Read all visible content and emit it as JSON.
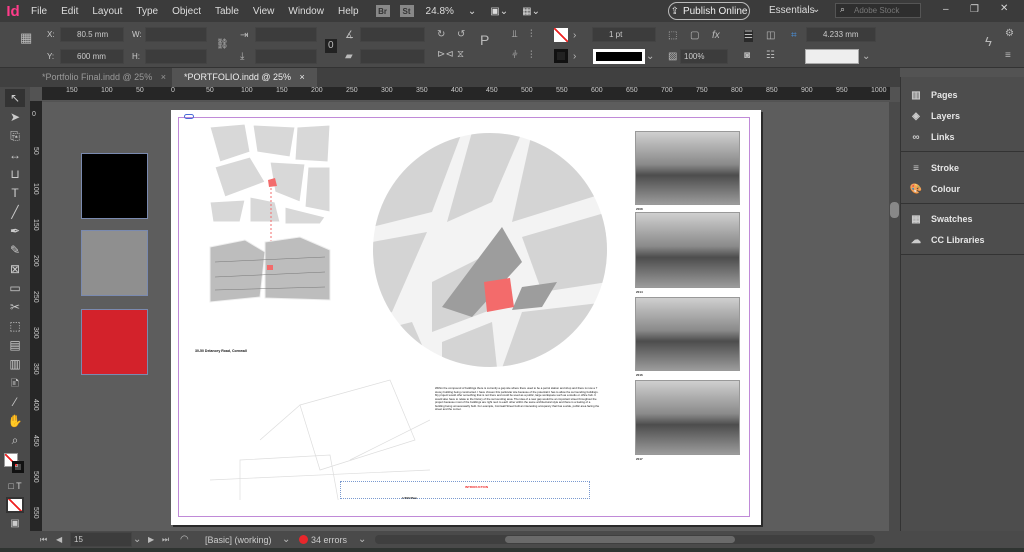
{
  "app": {
    "logo": "Id"
  },
  "menu": [
    "File",
    "Edit",
    "Layout",
    "Type",
    "Object",
    "Table",
    "View",
    "Window",
    "Help"
  ],
  "menubar": {
    "bridge": "Br",
    "stock_app": "St",
    "zoom": "24.8%",
    "publish": "Publish Online",
    "workspace": "Essentials",
    "search_placeholder": "Adobe Stock"
  },
  "control": {
    "x_label": "X:",
    "x_value": "80.5 mm",
    "y_label": "Y:",
    "y_value": "600 mm",
    "w_label": "W:",
    "h_label": "H:",
    "stroke_weight": "1 pt",
    "opacity": "100%",
    "offset": "4.233 mm"
  },
  "tabs": [
    {
      "label": "*Portfolio Final.indd @ 25%",
      "active": false
    },
    {
      "label": "*PORTFOLIO.indd @ 25%",
      "active": true
    }
  ],
  "close_glyph": "×",
  "hruler": [
    "150",
    "100",
    "50",
    "0",
    "50",
    "100",
    "150",
    "200",
    "250",
    "300",
    "350",
    "400",
    "450",
    "500",
    "550",
    "600",
    "650",
    "700",
    "750",
    "800",
    "850",
    "900",
    "950",
    "1000"
  ],
  "vruler": [
    "0",
    "50",
    "100",
    "150",
    "200",
    "250",
    "300",
    "350",
    "400",
    "450",
    "500",
    "550"
  ],
  "swatches": [
    {
      "name": "black",
      "color": "#000000"
    },
    {
      "name": "grey",
      "color": "#8f8f8f"
    },
    {
      "name": "red",
      "color": "#d3222b"
    }
  ],
  "page": {
    "address": "30-50 Delancey Road, Cornwall",
    "body_text": "Within the compound of buildings there is currently a gap site where there used to be a petrol station and shop and there is now a 7 storey building being constructed. I have chosen this particular site because of the potential it has to allow the surrounding buildings. My project would offer something that is not there and could be used as a public, large workspace such as a studio or office hub. It would also have to relate to the history of the surrounding area. The idea of a new gap would be an important street throughout the project because most of the buildings are right next to each other within the same architectural style and there is a feeling of a building being unnecessarily built. For example, Cornwall Street built an interesting occupancy that has a wide, public area facing the street and the corner.",
    "heading_red": "INTRODUCTION",
    "plan_label": "1:500 Plan",
    "photo_captions": [
      "2008",
      "2014",
      "2016",
      "2017"
    ],
    "highlight": "#f36b6b"
  },
  "panels": [
    {
      "group": 1,
      "items": [
        "Pages",
        "Layers",
        "Links"
      ]
    },
    {
      "group": 2,
      "items": [
        "Stroke",
        "Colour"
      ]
    },
    {
      "group": 3,
      "items": [
        "Swatches",
        "CC Libraries"
      ]
    }
  ],
  "status": {
    "page": "15",
    "preflight_profile": "[Basic] (working)",
    "errors": "34 errors",
    "error_color": "#e8262b"
  }
}
